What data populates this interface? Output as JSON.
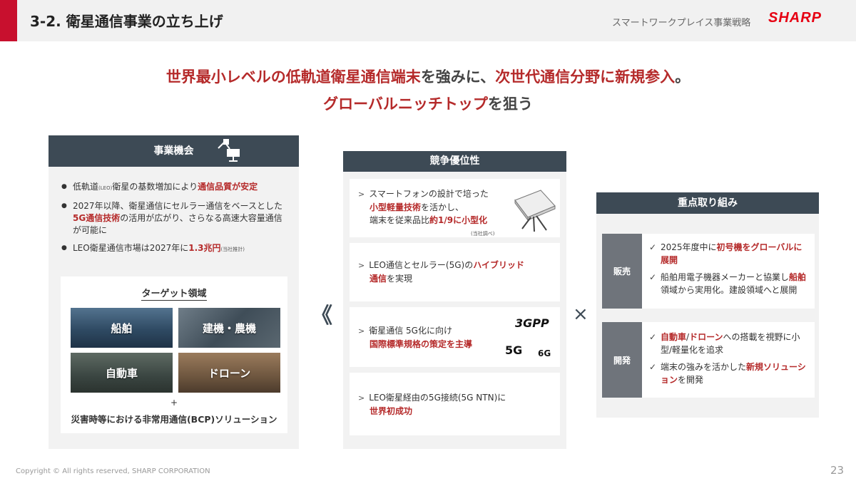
{
  "header": {
    "slide_title": "3-2. 衛星通信事業の立ち上げ",
    "subtitle": "スマートワークプレイス事業戦略",
    "logo": "SHARP"
  },
  "headline": {
    "line1_a": "世界最小レベルの低軌道衛星通信端末",
    "line1_b": "を強みに、",
    "line1_c": "次世代通信分野に新規参入",
    "line1_d": "。",
    "line2_a": "グローバルニッチトップ",
    "line2_b": "を狙う"
  },
  "opportunity": {
    "title": "事業機会",
    "b1_a": "低軌道",
    "b1_b": "(LEO)",
    "b1_c": "衛星の基数増加により",
    "b1_d": "通信品質が安定",
    "b2_a": "2027年以降、衛星通信にセルラー通信をベースとした",
    "b2_b": "5G通信技術",
    "b2_c": "の活用が広がり、さらなる高速大容量通信が可能に",
    "b3_a": "LEO衛星通信市場は2027年に",
    "b3_b": "1.3兆円",
    "b3_c": "(当社推計)",
    "target_title": "ターゲット領域",
    "tiles": [
      "船舶",
      "建機・農機",
      "自動車",
      "ドローン"
    ],
    "plus": "+",
    "bcp": "災害時等における非常用通信(BCP)ソリューション"
  },
  "chevron_left": "《",
  "cross": "×",
  "advantage": {
    "title": "競争優位性",
    "c1_a": "スマートフォンの設計で培った",
    "c1_b": "小型軽量技術",
    "c1_c": "を活かし、",
    "c1_d": "端末を従来品比",
    "c1_e": "約1/9に小型化",
    "c1_note": "(当社調べ)",
    "c2_a": "LEO通信とセルラー(5G)の",
    "c2_b": "ハイブリッド",
    "c2_c": "通信",
    "c2_d": "を実現",
    "c3_a": "衛星通信 5G化に向け",
    "c3_b": "国際標準規格の策定を主導",
    "logo_3gpp": "3GPP",
    "logo_5g_a": "5G",
    "logo_5g_b": "6G",
    "c4_a": "LEO衛星経由の5G接続(5G NTN)に",
    "c4_b": "世界初成功"
  },
  "focus": {
    "title": "重点取り組み",
    "sales_label": "販売",
    "s1_a": "2025年度中に",
    "s1_b": "初号機をグローバルに展開",
    "s2_a": "船舶用電子機器メーカーと協業し",
    "s2_b": "船舶",
    "s2_c": "領域から実用化。建設領域へと展開",
    "dev_label": "開発",
    "d1_a": "自動車",
    "d1_b": "/",
    "d1_c": "ドローン",
    "d1_d": "への搭載を視野に小型/軽量化を追求",
    "d2_a": "端末の強みを活かした",
    "d2_b": "新規ソリューション",
    "d2_c": "を開発"
  },
  "footer": {
    "copyright": "Copyright © All rights reserved, SHARP CORPORATION",
    "page": "23"
  },
  "colors": {
    "accent_red": "#b52a2a",
    "brand_red": "#e60012",
    "panel_header": "#3d4a55"
  },
  "icons": [
    "satellite-dish-icon",
    "satellite-terminal-image"
  ]
}
